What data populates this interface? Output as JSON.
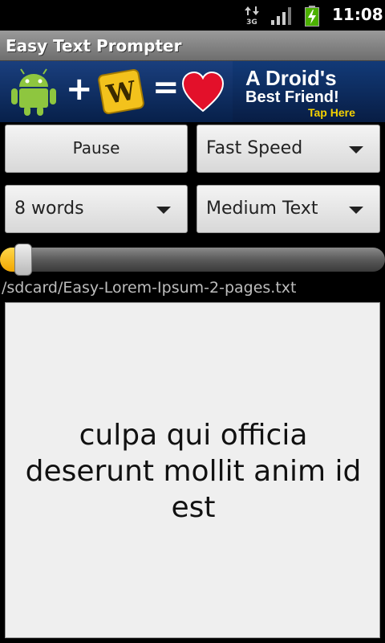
{
  "status_bar": {
    "network_type": "3G",
    "time": "11:08",
    "icons": [
      "data-arrows-icon",
      "signal-bars-icon",
      "battery-charging-icon"
    ]
  },
  "app": {
    "title": "Easy Text Prompter"
  },
  "ad_banner": {
    "line1": "A Droid's",
    "line2": "Best Friend!",
    "cta": "Tap Here",
    "tile_letter": "W",
    "icons": [
      "android-robot-icon",
      "letter-tile-icon",
      "heart-icon"
    ]
  },
  "controls": {
    "pause_button": "Pause",
    "speed_spinner": {
      "selected": "Fast Speed"
    },
    "words_spinner": {
      "selected": "8 words"
    },
    "text_size_spinner": {
      "selected": "Medium Text"
    }
  },
  "progress": {
    "fraction": 0.06
  },
  "file": {
    "path": "/sdcard/Easy-Lorem-Ipsum-2-pages.txt"
  },
  "prompter": {
    "text": "culpa qui officia deserunt mollit anim id est"
  },
  "colors": {
    "accent": "#f2a700",
    "title_bar": "#8a8a8a",
    "panel_bg": "#efefef"
  }
}
